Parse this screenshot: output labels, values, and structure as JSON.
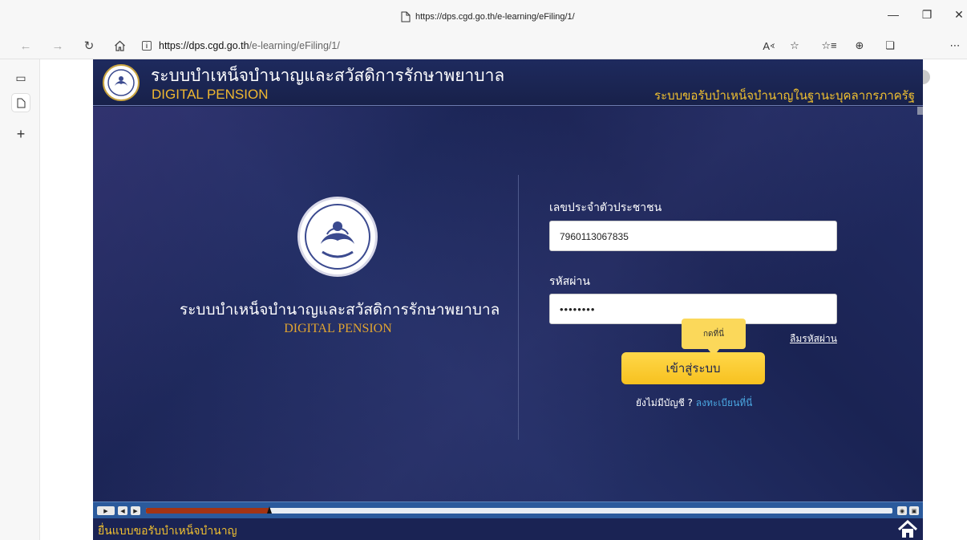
{
  "browser": {
    "window_title": "https://dps.cgd.go.th/e-learning/eFiling/1/",
    "url_host": "https://dps.cgd.go.th",
    "url_path": "/e-learning/eFiling/1/",
    "icons": [
      "back-icon",
      "forward-icon",
      "refresh-icon",
      "home-icon",
      "info-icon",
      "read-aloud-icon",
      "add-favorite-icon",
      "favorites-icon",
      "collections-icon",
      "extensions-icon",
      "profile-icon",
      "more-icon"
    ],
    "sidebar_icons": [
      "tab-actions-icon",
      "page-icon",
      "new-tab-icon"
    ]
  },
  "site": {
    "header_title": "ระบบบำเหน็จบำนาญและสวัสดิการรักษาพยาบาล",
    "header_subtitle": "DIGITAL PENSION",
    "header_right": "ระบบขอรับบำเหน็จบำนาญในฐานะบุคลากรภาครัฐ"
  },
  "login": {
    "left_title": "ระบบบำเหน็จบำนาญและสวัสดิการรักษาพยาบาล",
    "left_subtitle": "DIGITAL PENSION",
    "id_label": "เลขประจำตัวประชาชน",
    "id_value": "7960113067835",
    "password_label": "รหัสผ่าน",
    "password_value": "••••••••",
    "forgot_label": "ลืมรหัสผ่าน",
    "tooltip": "กดที่นี่",
    "login_button": "เข้าสู่ระบบ",
    "register_prompt": "ยังไม่มีบัญชี ?",
    "register_link": "ลงทะเบียนที่นี่"
  },
  "player": {
    "progress": 0.165,
    "footer_text": "ยื่นแบบขอรับบำเหน็จบำนาญ",
    "colors": {
      "progress_fill": "#a33414",
      "bar": "#2b5a9c",
      "accent": "#f7c11f"
    }
  }
}
